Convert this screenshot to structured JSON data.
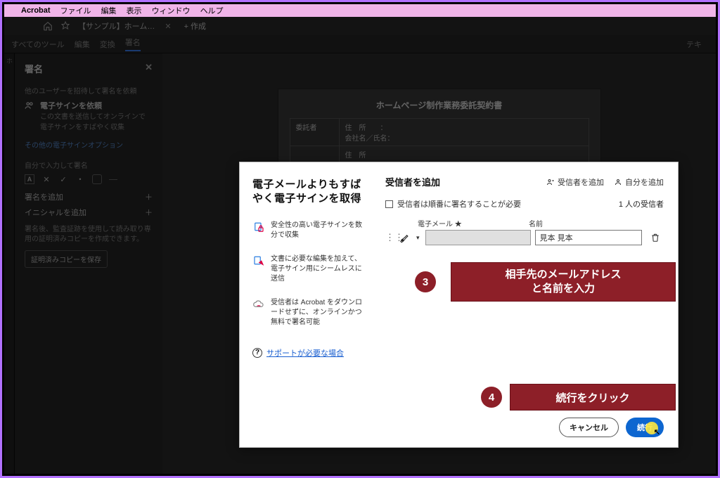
{
  "menubar": {
    "app": "Acrobat",
    "items": [
      "ファイル",
      "編集",
      "表示",
      "ウィンドウ",
      "ヘルプ"
    ]
  },
  "tabrow": {
    "tab_name": "【サンプル】ホーム…",
    "create": "+ 作成"
  },
  "toolrow": {
    "all_tools": "すべてのツール",
    "edit": "編集",
    "convert": "変換",
    "sign": "署名",
    "right": "テキ"
  },
  "leftnav": {
    "label": "ホ"
  },
  "sidepanel": {
    "title": "署名",
    "section_label": "他のユーザーを招待して署名を依頼",
    "feature_title": "電子サインを依頼",
    "feature_desc1": "この文書を送信してオンラインで",
    "feature_desc2": "電子サインをすばやく収集",
    "other_options": "その他の電子サインオプション",
    "self_label": "自分で入力して署名",
    "icon_letter": "A",
    "icon_x": "✕",
    "icon_check": "✓",
    "add_sign": "署名を追加",
    "add_initial": "イニシャルを追加",
    "note": "署名後、監査証跡を使用して読み取り専用の証明済みコピーを作成できます。",
    "save_btn": "証明済みコピーを保存"
  },
  "doc": {
    "title": "ホームページ制作業務委託契約書",
    "row1_label": "委託者",
    "row1_addr": "住　所　　：",
    "row1_name": "会社名／氏名：",
    "row2_addr": "住　所"
  },
  "modal": {
    "left_heading_l1": "電子メールよりもすば",
    "left_heading_l2": "やく電子サインを取得",
    "feat1": "安全性の高い電子サインを数分で収集",
    "feat2": "文書に必要な編集を加えて、電子サイン用にシームレスに送信",
    "feat3": "受信者は Acrobat をダウンロードせずに、オンラインかつ無料で署名可能",
    "support": "サポートが必要な場合",
    "right_title": "受信者を追加",
    "act_add": "受信者を追加",
    "act_self": "自分を追加",
    "order_text": "受信者は順番に署名することが必要",
    "count": "1 人の受信者",
    "email_label": "電子メール ★",
    "name_label": "名前",
    "name_value": "見本 見本",
    "cancel": "キャンセル",
    "continue": "続行"
  },
  "callouts": {
    "c3_l1": "相手先のメールアドレス",
    "c3_l2": "と名前を入力",
    "c4": "続行をクリック",
    "n3": "3",
    "n4": "4"
  }
}
